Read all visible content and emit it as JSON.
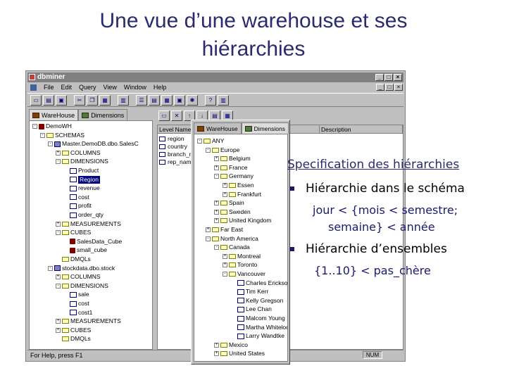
{
  "slide": {
    "title_line1": "Une vue d’une warehouse et ses",
    "title_line2": "hiérarchies"
  },
  "window": {
    "title": "dbminer",
    "menu": [
      "File",
      "Edit",
      "Query",
      "View",
      "Window",
      "Help"
    ],
    "status": "For Help, press F1",
    "num_indicator": "NUM"
  },
  "left_tabs": [
    "WareHouse",
    "Dimensions"
  ],
  "left_tree": [
    {
      "label": "DemoWH",
      "indent": 0,
      "expander": "-",
      "icon": "cube"
    },
    {
      "label": "SCHEMAS",
      "indent": 1,
      "expander": "-",
      "icon": "folder"
    },
    {
      "label": "Master.DemoDB.dbo.SalesC",
      "indent": 2,
      "expander": "-",
      "icon": "table"
    },
    {
      "label": "COLUMNS",
      "indent": 3,
      "expander": "+",
      "icon": "folder"
    },
    {
      "label": "DIMENSIONS",
      "indent": 3,
      "expander": "-",
      "icon": "folder"
    },
    {
      "label": "Product",
      "indent": 4,
      "expander": "",
      "icon": "dim"
    },
    {
      "label": "Region",
      "indent": 4,
      "expander": "",
      "icon": "dim",
      "selected": true
    },
    {
      "label": "revenue",
      "indent": 4,
      "expander": "",
      "icon": "dim"
    },
    {
      "label": "cost",
      "indent": 4,
      "expander": "",
      "icon": "dim"
    },
    {
      "label": "profit",
      "indent": 4,
      "expander": "",
      "icon": "dim"
    },
    {
      "label": "order_qty",
      "indent": 4,
      "expander": "",
      "icon": "dim"
    },
    {
      "label": "MEASUREMENTS",
      "indent": 3,
      "expander": "+",
      "icon": "folder"
    },
    {
      "label": "CUBES",
      "indent": 3,
      "expander": "-",
      "icon": "folder"
    },
    {
      "label": "SalesData_Cube",
      "indent": 4,
      "expander": "",
      "icon": "cube2"
    },
    {
      "label": "small_cube",
      "indent": 4,
      "expander": "",
      "icon": "cube2"
    },
    {
      "label": "DMQLs",
      "indent": 3,
      "expander": "",
      "icon": "folder"
    },
    {
      "label": "stockdata.dbo.stock",
      "indent": 2,
      "expander": "-",
      "icon": "table"
    },
    {
      "label": "COLUMNS",
      "indent": 3,
      "expander": "+",
      "icon": "folder"
    },
    {
      "label": "DIMENSIONS",
      "indent": 3,
      "expander": "-",
      "icon": "folder"
    },
    {
      "label": "sale",
      "indent": 4,
      "expander": "",
      "icon": "dim"
    },
    {
      "label": "cost",
      "indent": 4,
      "expander": "",
      "icon": "dim"
    },
    {
      "label": "cost1",
      "indent": 4,
      "expander": "",
      "icon": "dim"
    },
    {
      "label": "MEASUREMENTS",
      "indent": 3,
      "expander": "+",
      "icon": "folder"
    },
    {
      "label": "CUBES",
      "indent": 3,
      "expander": "+",
      "icon": "folder"
    },
    {
      "label": "DMQLs",
      "indent": 3,
      "expander": "",
      "icon": "folder"
    }
  ],
  "grid": {
    "headers": [
      "Level Name",
      "Description"
    ],
    "rows": [
      "region",
      "country",
      "branch_n",
      "rep_nam"
    ]
  },
  "overlay": {
    "tabs": [
      "WareHouse",
      "Dimensions"
    ],
    "tree": [
      {
        "label": "ANY",
        "indent": 0,
        "expander": "-"
      },
      {
        "label": "Europe",
        "indent": 1,
        "expander": "-"
      },
      {
        "label": "Belgium",
        "indent": 2,
        "expander": "+"
      },
      {
        "label": "France",
        "indent": 2,
        "expander": "+"
      },
      {
        "label": "Germany",
        "indent": 2,
        "expander": "-"
      },
      {
        "label": "Essen",
        "indent": 3,
        "expander": "+"
      },
      {
        "label": "Frankfurt",
        "indent": 3,
        "expander": "+"
      },
      {
        "label": "Spain",
        "indent": 2,
        "expander": "+"
      },
      {
        "label": "Sweden",
        "indent": 2,
        "expander": "+"
      },
      {
        "label": "United Kingdom",
        "indent": 2,
        "expander": "+"
      },
      {
        "label": "Far East",
        "indent": 1,
        "expander": "+"
      },
      {
        "label": "North America",
        "indent": 1,
        "expander": "-"
      },
      {
        "label": "Canada",
        "indent": 2,
        "expander": "-"
      },
      {
        "label": "Montreal",
        "indent": 3,
        "expander": "+"
      },
      {
        "label": "Toronto",
        "indent": 3,
        "expander": "+"
      },
      {
        "label": "Vancouver",
        "indent": 3,
        "expander": "-"
      },
      {
        "label": "Charles Erickson",
        "indent": 4,
        "expander": ""
      },
      {
        "label": "Tim Kerr",
        "indent": 4,
        "expander": ""
      },
      {
        "label": "Kelly Gregson",
        "indent": 4,
        "expander": ""
      },
      {
        "label": "Lee Chan",
        "indent": 4,
        "expander": ""
      },
      {
        "label": "Malcom Young",
        "indent": 4,
        "expander": ""
      },
      {
        "label": "Martha Whitelock",
        "indent": 4,
        "expander": ""
      },
      {
        "label": "Larry Wandtke",
        "indent": 4,
        "expander": ""
      },
      {
        "label": "Mexico",
        "indent": 2,
        "expander": "+"
      },
      {
        "label": "United States",
        "indent": 2,
        "expander": "+"
      }
    ]
  },
  "annotations": {
    "spec_heading": "Specification des hiérarchies",
    "bullet1": "Hiérarchie dans le schéma",
    "sub1_line1": "jour < {mois < semestre;",
    "sub1_line2": "semaine} < année",
    "bullet2": "Hiérarchie d’ensembles",
    "sub2": "{1..10} < pas_chère"
  },
  "colors": {
    "title": "#2a2a6e",
    "window_face": "#c0c0c0",
    "selection": "#000080",
    "bullet": "#1a1a6e"
  }
}
